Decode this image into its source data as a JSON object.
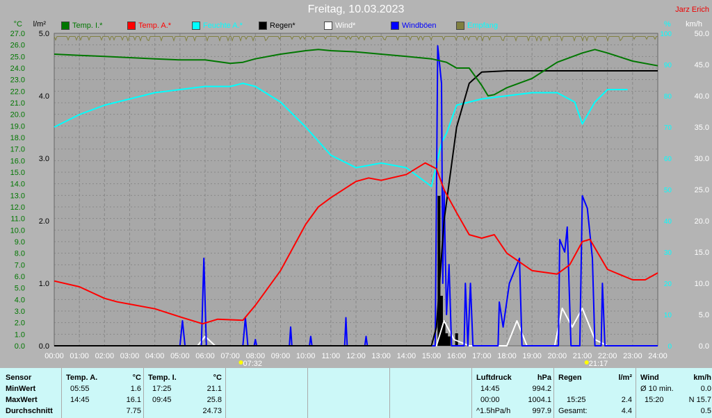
{
  "header": {
    "title": "Freitag, 10.03.2023",
    "owner": "Jarz Erich"
  },
  "axes": {
    "temp_unit": "°C",
    "rain_unit": "l/m²",
    "hum_unit": "%",
    "wind_unit": "km/h"
  },
  "legend": [
    {
      "label": "Temp. I.*",
      "color": "#007700"
    },
    {
      "label": "Temp. A.*",
      "color": "#ff0000"
    },
    {
      "label": "Feuchte A.*",
      "color": "#00ffff"
    },
    {
      "label": "Regen*",
      "color": "#000000"
    },
    {
      "label": "Wind*",
      "color": "#ffffff"
    },
    {
      "label": "Windböen",
      "color": "#0000ff"
    },
    {
      "label": "Empfang",
      "color": "#808040"
    }
  ],
  "sun": {
    "sunrise": "07:32",
    "sunset": "21:17"
  },
  "chart_data": {
    "type": "line",
    "title": "Freitag, 10.03.2023",
    "x_ticks": [
      "00:00",
      "01:00",
      "02:00",
      "03:00",
      "04:00",
      "05:00",
      "06:00",
      "07:00",
      "08:00",
      "09:00",
      "10:00",
      "11:00",
      "12:00",
      "13:00",
      "14:00",
      "15:00",
      "16:00",
      "17:00",
      "18:00",
      "19:00",
      "20:00",
      "21:00",
      "22:00",
      "23:00",
      "24:00"
    ],
    "xlim": [
      0,
      24
    ],
    "ylim_temp": [
      0,
      27
    ],
    "ylim_rain": [
      0,
      5
    ],
    "ylim_hum": [
      0,
      100
    ],
    "ylim_wind": [
      0,
      50
    ],
    "series": [
      {
        "name": "Temp. I.*",
        "axis": "temp",
        "color": "#007700",
        "points": [
          [
            0,
            25.2
          ],
          [
            1,
            25.1
          ],
          [
            2,
            25.0
          ],
          [
            3,
            24.9
          ],
          [
            4,
            24.8
          ],
          [
            5,
            24.7
          ],
          [
            6,
            24.7
          ],
          [
            7,
            24.4
          ],
          [
            7.5,
            24.5
          ],
          [
            8,
            24.8
          ],
          [
            9,
            25.2
          ],
          [
            10,
            25.5
          ],
          [
            10.5,
            25.6
          ],
          [
            11,
            25.5
          ],
          [
            12,
            25.4
          ],
          [
            13,
            25.2
          ],
          [
            14,
            25.0
          ],
          [
            15,
            24.8
          ],
          [
            15.6,
            24.5
          ],
          [
            16,
            24.0
          ],
          [
            16.5,
            24.0
          ],
          [
            17,
            22.5
          ],
          [
            17.25,
            21.6
          ],
          [
            17.5,
            21.7
          ],
          [
            18,
            22.3
          ],
          [
            19,
            23.1
          ],
          [
            20,
            24.5
          ],
          [
            21,
            25.3
          ],
          [
            21.5,
            25.6
          ],
          [
            22,
            25.3
          ],
          [
            23,
            24.6
          ],
          [
            24,
            24.2
          ]
        ]
      },
      {
        "name": "Temp. A.*",
        "axis": "temp",
        "color": "#ff0000",
        "points": [
          [
            0,
            5.6
          ],
          [
            1,
            5.1
          ],
          [
            2,
            4.1
          ],
          [
            2.5,
            3.8
          ],
          [
            3,
            3.6
          ],
          [
            4,
            3.2
          ],
          [
            5,
            2.5
          ],
          [
            5.9,
            1.9
          ],
          [
            6.5,
            2.3
          ],
          [
            7.5,
            2.2
          ],
          [
            8,
            3.5
          ],
          [
            9,
            6.5
          ],
          [
            10,
            10.5
          ],
          [
            10.5,
            12.0
          ],
          [
            11,
            12.8
          ],
          [
            12,
            14.2
          ],
          [
            12.5,
            14.5
          ],
          [
            13,
            14.3
          ],
          [
            14,
            14.8
          ],
          [
            14.75,
            15.8
          ],
          [
            15.2,
            15.3
          ],
          [
            15.5,
            13.5
          ],
          [
            16,
            11.5
          ],
          [
            16.5,
            9.6
          ],
          [
            17,
            9.3
          ],
          [
            17.5,
            9.6
          ],
          [
            18,
            8.0
          ],
          [
            19,
            6.5
          ],
          [
            20,
            6.2
          ],
          [
            20.5,
            7.0
          ],
          [
            21,
            9.0
          ],
          [
            21.3,
            9.2
          ],
          [
            22,
            6.6
          ],
          [
            23,
            5.7
          ],
          [
            23.5,
            5.7
          ],
          [
            24,
            6.3
          ]
        ]
      },
      {
        "name": "Feuchte A.*",
        "axis": "hum",
        "color": "#00ffff",
        "points": [
          [
            0,
            70
          ],
          [
            1,
            74
          ],
          [
            2,
            77
          ],
          [
            3,
            79
          ],
          [
            4,
            81
          ],
          [
            5,
            82
          ],
          [
            6,
            83
          ],
          [
            7,
            83
          ],
          [
            7.5,
            84
          ],
          [
            8,
            83
          ],
          [
            9,
            78
          ],
          [
            10,
            70
          ],
          [
            11,
            61
          ],
          [
            12,
            57
          ],
          [
            13,
            58.5
          ],
          [
            14,
            57
          ],
          [
            15,
            51
          ],
          [
            15.4,
            65
          ],
          [
            15.6,
            68
          ],
          [
            16,
            77
          ],
          [
            17,
            79
          ],
          [
            18,
            80
          ],
          [
            19,
            81
          ],
          [
            20,
            81
          ],
          [
            20.7,
            78
          ],
          [
            21,
            71
          ],
          [
            21.5,
            78
          ],
          [
            22,
            82
          ],
          [
            22.8,
            82
          ]
        ]
      },
      {
        "name": "Regen*",
        "axis": "rain",
        "color": "#000000",
        "points": [
          [
            0,
            0
          ],
          [
            15.0,
            0
          ],
          [
            15.2,
            0.3
          ],
          [
            15.5,
            2.0
          ],
          [
            16,
            3.5
          ],
          [
            16.5,
            4.2
          ],
          [
            17,
            4.38
          ],
          [
            18,
            4.4
          ],
          [
            24,
            4.4
          ]
        ]
      },
      {
        "name": "Wind*",
        "axis": "wind",
        "color": "#ffffff",
        "points": [
          [
            5.7,
            0
          ],
          [
            6,
            1.5
          ],
          [
            6.4,
            0
          ],
          [
            15.2,
            0
          ],
          [
            15.5,
            4
          ],
          [
            15.9,
            1
          ],
          [
            16.5,
            0
          ],
          [
            18.0,
            0
          ],
          [
            18.4,
            4
          ],
          [
            18.8,
            0
          ],
          [
            19.9,
            0
          ],
          [
            20.2,
            6
          ],
          [
            20.6,
            3
          ],
          [
            21,
            6
          ],
          [
            21.5,
            1
          ],
          [
            22,
            0
          ]
        ]
      },
      {
        "name": "Windböen",
        "axis": "wind",
        "color": "#0000ff",
        "points": [
          [
            0,
            0
          ],
          [
            5.0,
            0
          ],
          [
            5.1,
            4
          ],
          [
            5.2,
            0
          ],
          [
            5.85,
            0
          ],
          [
            5.95,
            14
          ],
          [
            6.05,
            0
          ],
          [
            7.5,
            0
          ],
          [
            7.6,
            4.5
          ],
          [
            7.7,
            0
          ],
          [
            7.95,
            0
          ],
          [
            8.0,
            1
          ],
          [
            8.05,
            0
          ],
          [
            9.35,
            0
          ],
          [
            9.4,
            3
          ],
          [
            9.45,
            0
          ],
          [
            10.15,
            0
          ],
          [
            10.2,
            1.5
          ],
          [
            10.25,
            0
          ],
          [
            11.55,
            0
          ],
          [
            11.6,
            4.5
          ],
          [
            11.65,
            0
          ],
          [
            12.35,
            0
          ],
          [
            12.4,
            1.5
          ],
          [
            12.45,
            0
          ],
          [
            15.15,
            0
          ],
          [
            15.25,
            48
          ],
          [
            15.4,
            42
          ],
          [
            15.45,
            10
          ],
          [
            15.5,
            25
          ],
          [
            15.6,
            5
          ],
          [
            15.7,
            13
          ],
          [
            15.8,
            0
          ],
          [
            16.3,
            0
          ],
          [
            16.35,
            10
          ],
          [
            16.45,
            0
          ],
          [
            16.55,
            10
          ],
          [
            16.65,
            0
          ],
          [
            17.65,
            0
          ],
          [
            17.7,
            7
          ],
          [
            17.85,
            3
          ],
          [
            18.1,
            10
          ],
          [
            18.5,
            14
          ],
          [
            18.6,
            0
          ],
          [
            20.05,
            0
          ],
          [
            20.1,
            17
          ],
          [
            20.3,
            15
          ],
          [
            20.4,
            19
          ],
          [
            20.55,
            0
          ],
          [
            20.9,
            0
          ],
          [
            21.0,
            24
          ],
          [
            21.2,
            22
          ],
          [
            21.4,
            14
          ],
          [
            21.5,
            0
          ],
          [
            21.75,
            0
          ],
          [
            21.8,
            10
          ],
          [
            21.9,
            0
          ],
          [
            24,
            0
          ]
        ]
      }
    ],
    "rain_bars": [
      [
        15.3,
        2.4
      ],
      [
        15.4,
        0.8
      ],
      [
        15.5,
        0.4
      ],
      [
        15.6,
        0.2
      ],
      [
        15.7,
        0.15
      ],
      [
        16.0,
        0.2
      ]
    ],
    "empfang_level": 99
  },
  "table": {
    "sensor": {
      "h": "Sensor",
      "min": "MinWert",
      "max": "MaxWert",
      "avg": "Durchschnitt"
    },
    "ta": {
      "h": "Temp. A.",
      "u": "°C",
      "min_t": "05:55",
      "min": "1.6",
      "max_t": "14:45",
      "max": "16.1",
      "avg": "7.75"
    },
    "ti": {
      "h": "Temp. I.",
      "u": "°C",
      "min_t": "17:25",
      "min": "21.1",
      "max_t": "09:45",
      "max": "25.8",
      "avg": "24.73"
    },
    "lp": {
      "h": "Luftdruck",
      "u": "hPa",
      "min_t": "14:45",
      "min": "994.2",
      "max_t": "00:00",
      "max": "1004.1",
      "avg_t": "^1.5hPa/h",
      "avg": "997.9"
    },
    "rg": {
      "h": "Regen",
      "u": "l/m²",
      "max_t": "15:25",
      "max": "2.4",
      "avg_t": "Gesamt:",
      "avg": "4.4"
    },
    "wd": {
      "h": "Wind",
      "u": "km/h",
      "min_t": "Ø 10 min.",
      "min": "0.0",
      "max_t": "15:20",
      "max": "N 15.7",
      "avg": "0.5"
    }
  }
}
